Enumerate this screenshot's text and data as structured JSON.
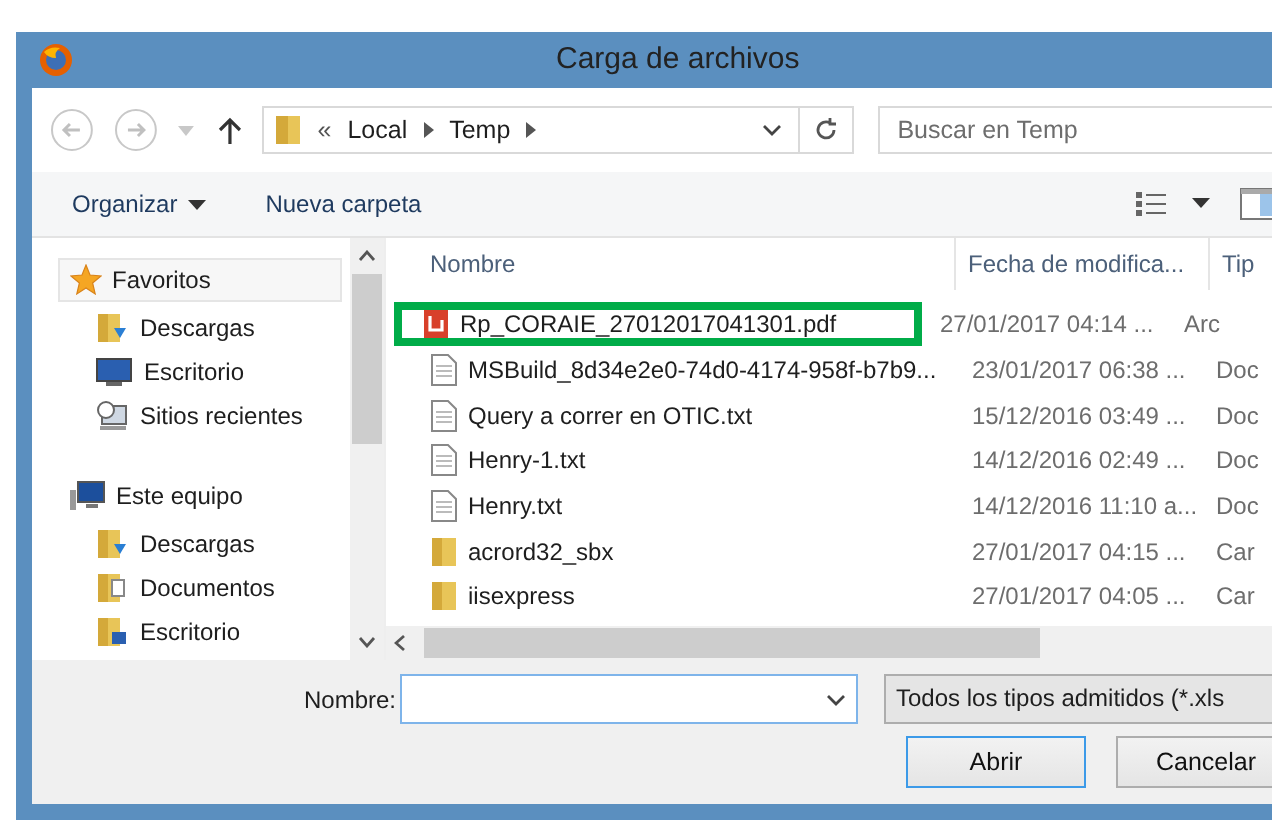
{
  "window": {
    "title": "Carga de archivos"
  },
  "address": {
    "overflow": "«",
    "crumbs": [
      "Local",
      "Temp"
    ]
  },
  "search": {
    "placeholder": "Buscar en Temp"
  },
  "toolbar": {
    "organize": "Organizar",
    "new_folder": "Nueva carpeta"
  },
  "sidebar": {
    "groups": [
      {
        "label": "Favoritos",
        "kind": "star",
        "selected": true,
        "children": [
          {
            "label": "Descargas",
            "kind": "downloads"
          },
          {
            "label": "Escritorio",
            "kind": "desktop"
          },
          {
            "label": "Sitios recientes",
            "kind": "recent"
          }
        ]
      },
      {
        "label": "Este equipo",
        "kind": "computer",
        "selected": false,
        "children": [
          {
            "label": "Descargas",
            "kind": "downloads"
          },
          {
            "label": "Documentos",
            "kind": "documents"
          },
          {
            "label": "Escritorio",
            "kind": "desktop-folder"
          }
        ]
      }
    ]
  },
  "table": {
    "columns": [
      "Nombre",
      "Fecha de modifica...",
      "Tip"
    ],
    "rows": [
      {
        "name": "Rp_CORAIE_27012017041301.pdf",
        "date": "27/01/2017 04:14 ...",
        "type": "Arc",
        "kind": "pdf",
        "highlighted": true
      },
      {
        "name": "MSBuild_8d34e2e0-74d0-4174-958f-b7b9...",
        "date": "23/01/2017 06:38 ...",
        "type": "Doc",
        "kind": "txt",
        "highlighted": false
      },
      {
        "name": "Query a correr en OTIC.txt",
        "date": "15/12/2016 03:49 ...",
        "type": "Doc",
        "kind": "txt",
        "highlighted": false
      },
      {
        "name": "Henry-1.txt",
        "date": "14/12/2016 02:49 ...",
        "type": "Doc",
        "kind": "txt",
        "highlighted": false
      },
      {
        "name": "Henry.txt",
        "date": "14/12/2016 11:10 a...",
        "type": "Doc",
        "kind": "txt",
        "highlighted": false
      },
      {
        "name": "acrord32_sbx",
        "date": "27/01/2017 04:15 ...",
        "type": "Car",
        "kind": "folder",
        "highlighted": false
      },
      {
        "name": "iisexpress",
        "date": "27/01/2017 04:05 ...",
        "type": "Car",
        "kind": "folder",
        "highlighted": false
      }
    ]
  },
  "footer": {
    "name_label": "Nombre:",
    "filter": "Todos los tipos admitidos (*.xls",
    "buttons": [
      {
        "label": "Abrir",
        "kind": "default"
      },
      {
        "label": "Cancelar",
        "kind": "normal"
      }
    ]
  }
}
